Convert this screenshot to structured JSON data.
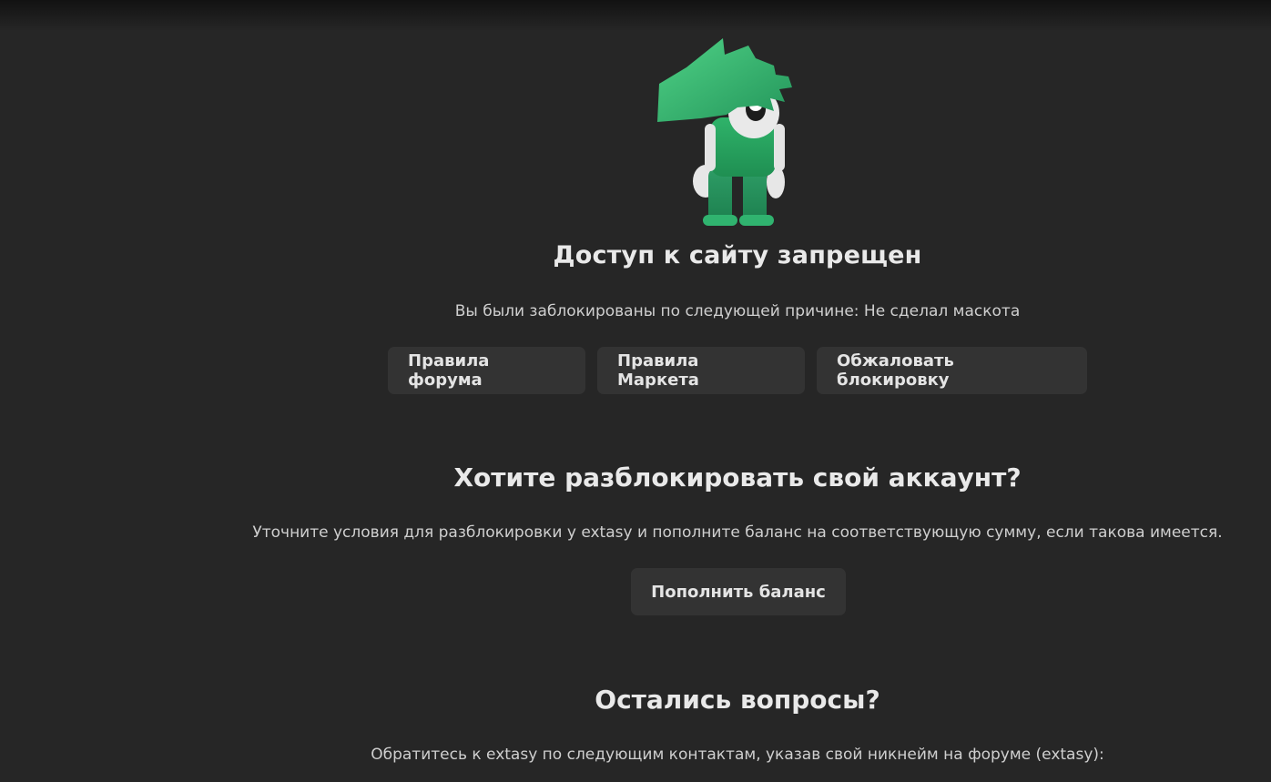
{
  "blocked": {
    "title": "Доступ к сайту запрещен",
    "reason": "Вы были заблокированы по следующей причине: Не сделал маскота"
  },
  "actions": {
    "forum_rules": "Правила форума",
    "market_rules": "Правила Маркета",
    "appeal": "Обжаловать блокировку"
  },
  "unlock": {
    "title": "Хотите разблокировать свой аккаунт?",
    "description": "Уточните условия для разблокировки у extasy и пополните баланс на соответствующую сумму, если такова имеется.",
    "topup_button": "Пополнить баланс"
  },
  "questions": {
    "title": "Остались вопросы?",
    "description": "Обратитесь к extasy по следующим контактам, указав свой никнейм на форуме (extasy):"
  },
  "colors": {
    "background": "#262626",
    "button": "#333333",
    "text_primary": "#e9e9e9",
    "text_secondary": "#cfcfcf",
    "mascot_green": "#2ea865"
  },
  "icons": {
    "mascot": "green-haired-mascot-illustration"
  }
}
